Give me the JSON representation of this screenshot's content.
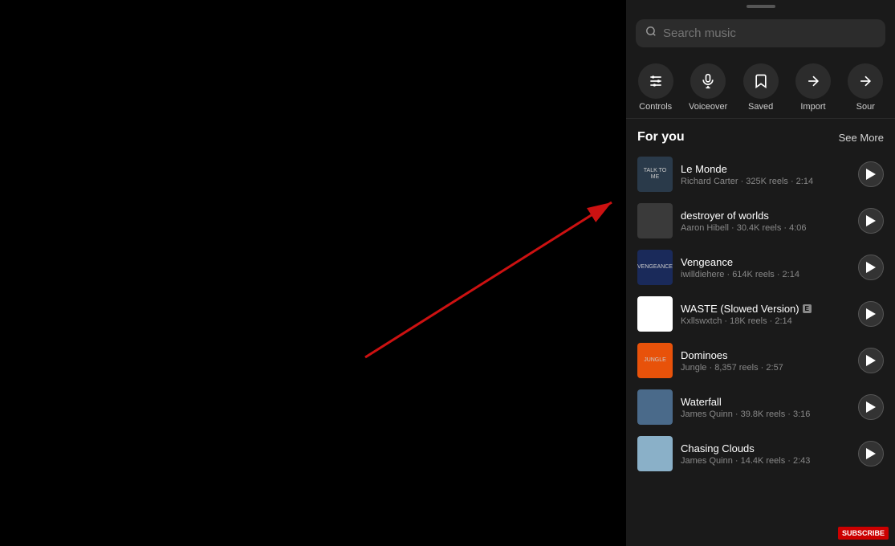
{
  "search": {
    "placeholder": "Search music"
  },
  "actions": [
    {
      "id": "controls",
      "label": "Controls",
      "icon": "sliders"
    },
    {
      "id": "voiceover",
      "label": "Voiceover",
      "icon": "mic"
    },
    {
      "id": "saved",
      "label": "Saved",
      "icon": "bookmark"
    },
    {
      "id": "import",
      "label": "Import",
      "icon": "arrow-right"
    },
    {
      "id": "sounds",
      "label": "Sour",
      "icon": "arrow-right2"
    }
  ],
  "section": {
    "title": "For you",
    "see_more": "See More"
  },
  "tracks": [
    {
      "title": "Le Monde",
      "artist": "Richard Carter",
      "reels": "325K reels",
      "duration": "2:14",
      "thumb_class": "thumb-talktome",
      "thumb_text": "TALK TO ME",
      "explicit": false
    },
    {
      "title": "destroyer of worlds",
      "artist": "Aaron Hibell",
      "reels": "30.4K reels",
      "duration": "4:06",
      "thumb_class": "thumb-destroyer",
      "thumb_text": "",
      "explicit": false
    },
    {
      "title": "Vengeance",
      "artist": "iwilldiehere",
      "reels": "614K reels",
      "duration": "2:14",
      "thumb_class": "thumb-vengeance",
      "thumb_text": "VENGEANCE",
      "explicit": false
    },
    {
      "title": "WASTE (Slowed Version)",
      "artist": "Kxllswxtch",
      "reels": "18K reels",
      "duration": "2:14",
      "thumb_class": "thumb-waste",
      "thumb_text": "",
      "explicit": true
    },
    {
      "title": "Dominoes",
      "artist": "Jungle",
      "reels": "8,357 reels",
      "duration": "2:57",
      "thumb_class": "thumb-dominoes",
      "thumb_text": "JUNGLE",
      "explicit": false
    },
    {
      "title": "Waterfall",
      "artist": "James Quinn",
      "reels": "39.8K reels",
      "duration": "3:16",
      "thumb_class": "thumb-waterfall",
      "thumb_text": "",
      "explicit": false
    },
    {
      "title": "Chasing Clouds",
      "artist": "James Quinn",
      "reels": "14.4K reels",
      "duration": "2:43",
      "thumb_class": "thumb-chasing",
      "thumb_text": "",
      "explicit": false
    }
  ],
  "subscribe": "SUBSCRIBE",
  "arrow": {
    "description": "Red arrow pointing to search bar"
  }
}
